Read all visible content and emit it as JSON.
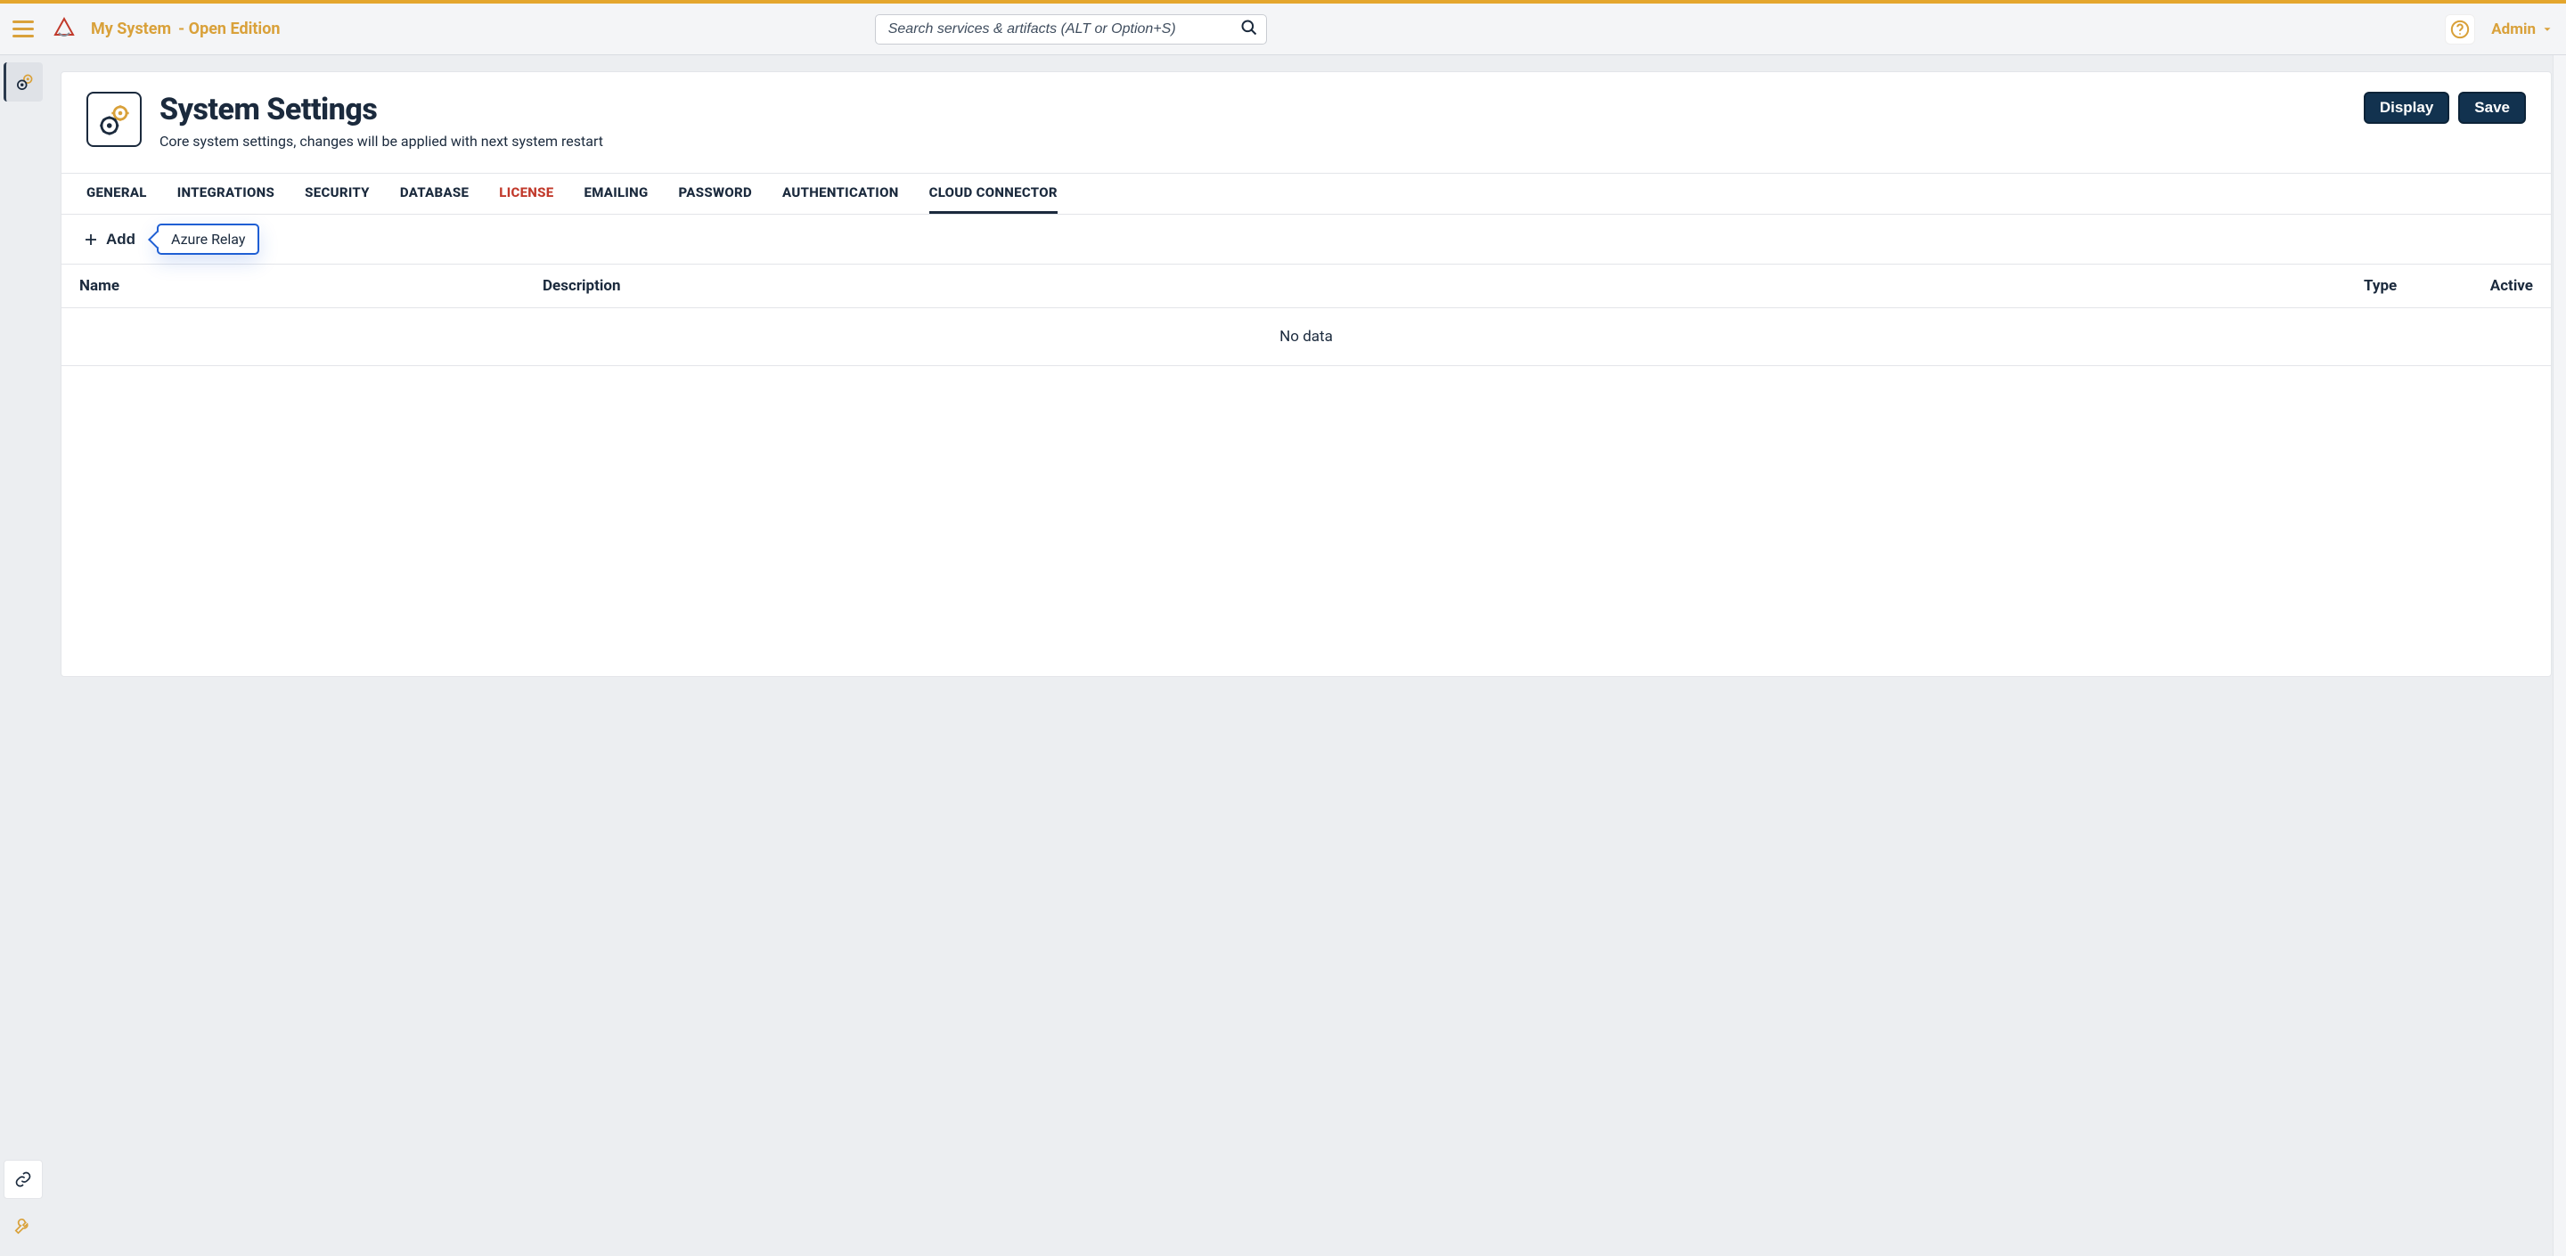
{
  "header": {
    "system_name": "My System",
    "edition": "- Open Edition",
    "search_placeholder": "Search services & artifacts (ALT or Option+S)",
    "admin_label": "Admin"
  },
  "page": {
    "title": "System Settings",
    "subtitle": "Core system settings, changes will be applied with next system restart",
    "display_button": "Display",
    "save_button": "Save"
  },
  "tabs": [
    {
      "label": "GENERAL",
      "highlight": false,
      "active": false
    },
    {
      "label": "INTEGRATIONS",
      "highlight": false,
      "active": false
    },
    {
      "label": "SECURITY",
      "highlight": false,
      "active": false
    },
    {
      "label": "DATABASE",
      "highlight": false,
      "active": false
    },
    {
      "label": "LICENSE",
      "highlight": true,
      "active": false
    },
    {
      "label": "EMAILING",
      "highlight": false,
      "active": false
    },
    {
      "label": "PASSWORD",
      "highlight": false,
      "active": false
    },
    {
      "label": "AUTHENTICATION",
      "highlight": false,
      "active": false
    },
    {
      "label": "CLOUD CONNECTOR",
      "highlight": false,
      "active": true
    }
  ],
  "toolbar": {
    "add_label": "Add",
    "popover_option": "Azure Relay"
  },
  "table": {
    "columns": {
      "name": "Name",
      "description": "Description",
      "type": "Type",
      "active": "Active"
    },
    "empty_text": "No data",
    "rows": []
  }
}
